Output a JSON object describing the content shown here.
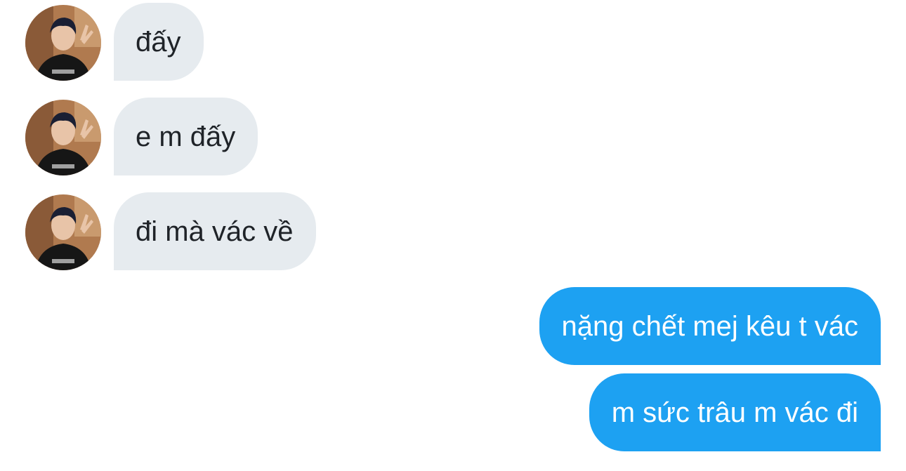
{
  "conversation": {
    "incoming": [
      {
        "text": "đấy",
        "avatar": "user-avatar-photo"
      },
      {
        "text": "e m đấy",
        "avatar": "user-avatar-photo"
      },
      {
        "text": "đi mà vác về",
        "avatar": "user-avatar-photo"
      }
    ],
    "outgoing": [
      {
        "text": "nặng chết mej kêu t vác"
      },
      {
        "text": "m sức trâu m vác đi"
      }
    ]
  },
  "colors": {
    "incoming_bubble": "#e6ebef",
    "outgoing_bubble": "#1da1f2",
    "incoming_text": "#1f2328",
    "outgoing_text": "#ffffff"
  }
}
